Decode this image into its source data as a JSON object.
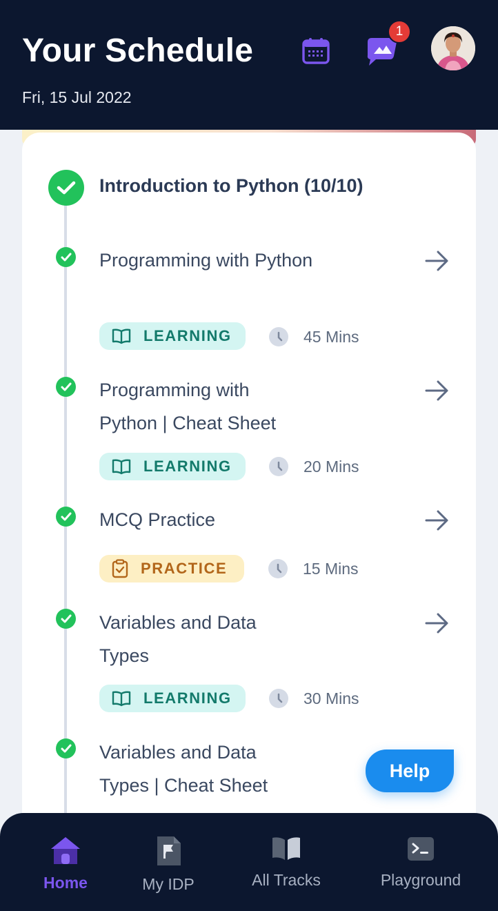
{
  "header": {
    "title": "Your Schedule",
    "date": "Fri, 15 Jul 2022",
    "notification_count": "1"
  },
  "module": {
    "title": "Introduction to Python (10/10)"
  },
  "items": [
    {
      "title": "Programming with Python",
      "tag": "LEARNING",
      "duration": "45 Mins"
    },
    {
      "title": "Programming with Python | Cheat Sheet",
      "tag": "LEARNING",
      "duration": "20 Mins"
    },
    {
      "title": "MCQ Practice",
      "tag": "PRACTICE",
      "duration": "15 Mins"
    },
    {
      "title": "Variables and Data Types",
      "tag": "LEARNING",
      "duration": "30 Mins"
    },
    {
      "title": "Variables and Data Types | Cheat Sheet"
    }
  ],
  "help_button": "Help",
  "bottom_nav": [
    {
      "label": "Home",
      "icon": "home-icon",
      "active": true
    },
    {
      "label": "My IDP",
      "icon": "document-flag-icon"
    },
    {
      "label": "All Tracks",
      "icon": "open-book-icon"
    },
    {
      "label": "Playground",
      "icon": "terminal-icon"
    }
  ],
  "colors": {
    "header_bg": "#0c172f",
    "accent": "#7b56ee",
    "success": "#22c25b",
    "help": "#1a8cee",
    "badge": "#e43b37"
  }
}
